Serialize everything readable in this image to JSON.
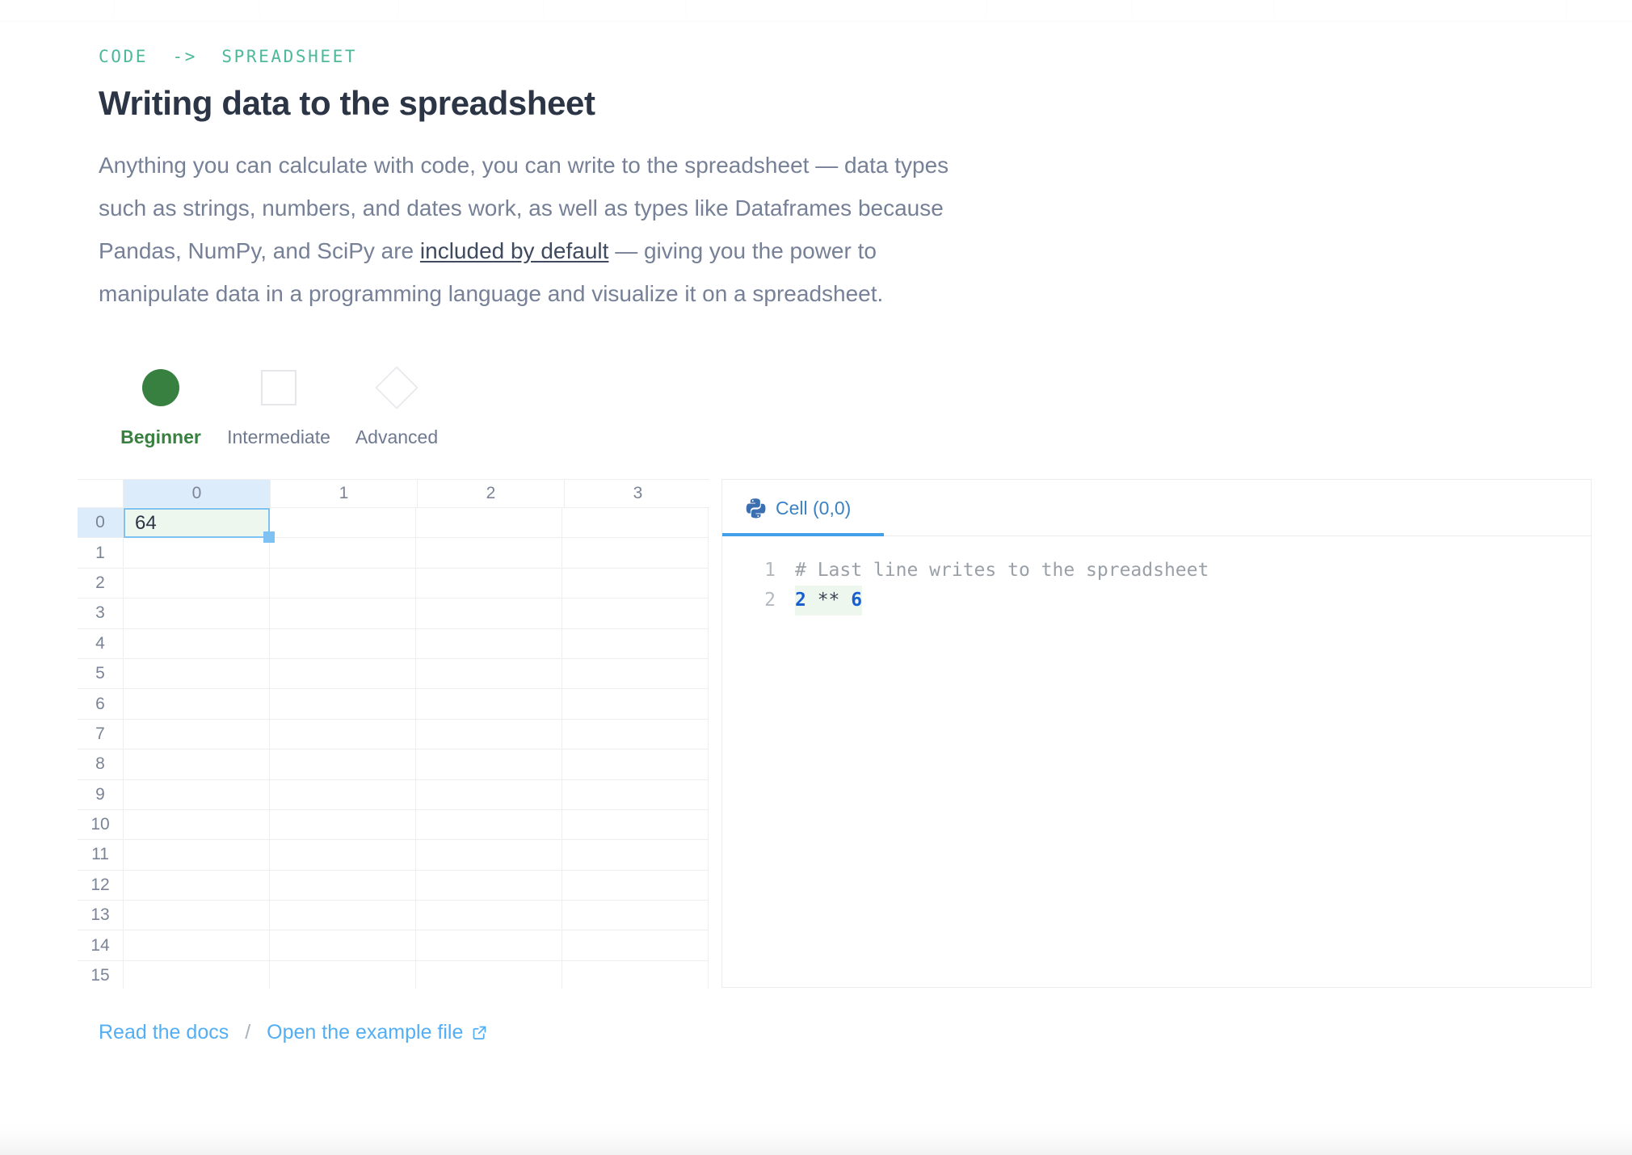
{
  "eyebrow": "CODE  ->  SPREADSHEET",
  "headline": "Writing data to the spreadsheet",
  "lede": {
    "part1": "Anything you can calculate with code, you can write to the spreadsheet — data types such as strings, numbers, and dates work, as well as types like Dataframes because Pandas, NumPy, and SciPy are ",
    "link": "included by default",
    "part2": " — giving you the power to manipulate data in a programming language and visualize it on a spreadsheet."
  },
  "levels": {
    "items": [
      {
        "label": "Beginner",
        "glyph": "circle-icon",
        "active": true
      },
      {
        "label": "Intermediate",
        "glyph": "square-icon",
        "active": false
      },
      {
        "label": "Advanced",
        "glyph": "diamond-icon",
        "active": false
      }
    ]
  },
  "spreadsheet": {
    "column_headers": [
      "0",
      "1",
      "2",
      "3"
    ],
    "row_headers": [
      "0",
      "1",
      "2",
      "3",
      "4",
      "5",
      "6",
      "7",
      "8",
      "9",
      "10",
      "11",
      "12",
      "13",
      "14",
      "15"
    ],
    "selected_cell": {
      "row": 0,
      "col": 0,
      "value": "64"
    },
    "cells": [
      [
        "64",
        "",
        "",
        ""
      ],
      [
        "",
        "",
        "",
        ""
      ],
      [
        "",
        "",
        "",
        ""
      ],
      [
        "",
        "",
        "",
        ""
      ],
      [
        "",
        "",
        "",
        ""
      ],
      [
        "",
        "",
        "",
        ""
      ],
      [
        "",
        "",
        "",
        ""
      ],
      [
        "",
        "",
        "",
        ""
      ],
      [
        "",
        "",
        "",
        ""
      ],
      [
        "",
        "",
        "",
        ""
      ],
      [
        "",
        "",
        "",
        ""
      ],
      [
        "",
        "",
        "",
        ""
      ],
      [
        "",
        "",
        "",
        ""
      ],
      [
        "",
        "",
        "",
        ""
      ],
      [
        "",
        "",
        "",
        ""
      ],
      [
        "",
        "",
        "",
        ""
      ]
    ],
    "selection_border_color": "#7ec2f3",
    "selection_fill_color": "#edf7ed",
    "header_highlight_color": "#dcecfb"
  },
  "code_panel": {
    "tab_label": "Cell (0,0)",
    "tab_icon": "python-icon",
    "tab_color": "#3b82c4",
    "underline_color": "#42a0e8",
    "lines": [
      {
        "number": "1",
        "comment": "# Last line writes to the spreadsheet"
      },
      {
        "number": "2",
        "base": "2",
        "op": " ** ",
        "exp": "6"
      }
    ]
  },
  "footer": {
    "docs_link": "Read the docs",
    "separator": "/",
    "example_link": "Open the example file",
    "external_icon": "external-link-icon"
  },
  "colors": {
    "eyebrow": "#4db89a",
    "headline": "#2b3545",
    "body": "#768096",
    "accent_green": "#38803f",
    "accent_blue": "#53aef3"
  }
}
